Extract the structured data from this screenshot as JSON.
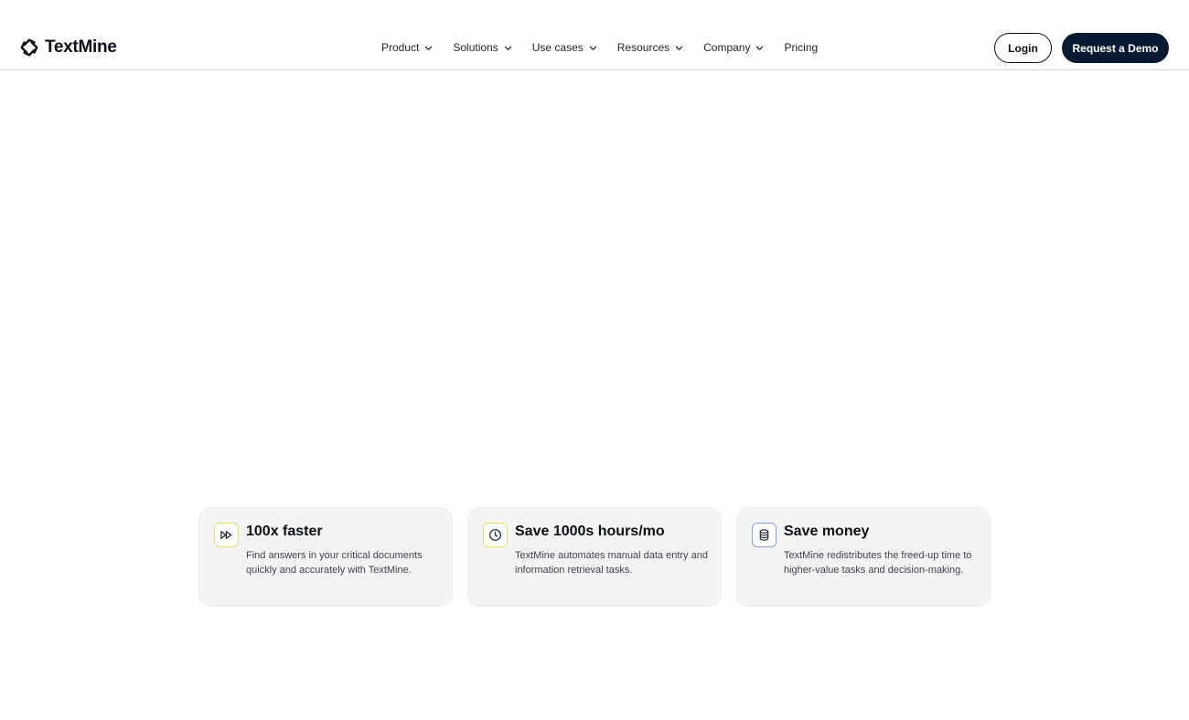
{
  "brand": {
    "name": "TextMine"
  },
  "nav": [
    {
      "label": "Product",
      "has_dropdown": true
    },
    {
      "label": "Solutions",
      "has_dropdown": true
    },
    {
      "label": "Use cases",
      "has_dropdown": true
    },
    {
      "label": "Resources",
      "has_dropdown": true
    },
    {
      "label": "Company",
      "has_dropdown": true
    },
    {
      "label": "Pricing",
      "has_dropdown": false
    }
  ],
  "actions": {
    "login_label": "Login",
    "demo_label": "Request a Demo"
  },
  "features": [
    {
      "icon": "fast-forward-icon",
      "title": "100x faster",
      "description": "Find answers in your critical documents quickly and accurately with TextMine."
    },
    {
      "icon": "clock-icon",
      "title": "Save 1000s hours/mo",
      "description": "TextMine automates manual data entry and information retrieval tasks."
    },
    {
      "icon": "database-icon",
      "title": "Save money",
      "description": "TextMine redistributes the freed-up time to higher-value tasks and decision-making."
    }
  ],
  "colors": {
    "primary_dark": "#081a33",
    "card_bg": "#f4f4f4",
    "icon_border_yellow": "#e8dd6a",
    "icon_border_blue": "#8a9be6"
  }
}
